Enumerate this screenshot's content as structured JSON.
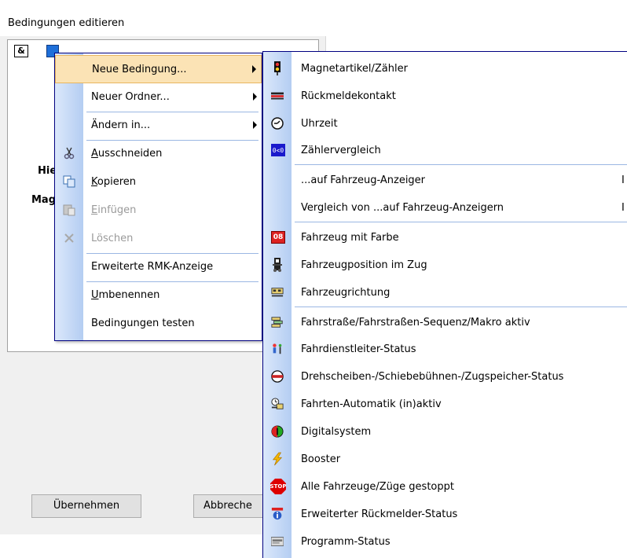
{
  "dialog": {
    "title": "Bedingungen editieren",
    "tree_and_label": "&",
    "tree_label_1": "Hie",
    "tree_label_2": "Mag",
    "apply_button": "Übernehmen",
    "cancel_button": "Abbreche"
  },
  "context_menu": {
    "items": [
      {
        "label": "Neue Bedingung...",
        "submenu": true,
        "highlighted": true
      },
      {
        "label": "Neuer Ordner...",
        "submenu": true
      },
      {
        "label": "Ändern in...",
        "submenu": true
      },
      {
        "label": "Ausschneiden",
        "icon": "scissors-icon",
        "mnemonic": "A"
      },
      {
        "label": "Kopieren",
        "icon": "copy-icon",
        "mnemonic": "K"
      },
      {
        "label": "Einfügen",
        "icon": "paste-icon",
        "mnemonic": "E",
        "disabled": true
      },
      {
        "label": "Löschen",
        "icon": "delete-icon",
        "disabled": true
      },
      {
        "label": "Erweiterte RMK-Anzeige"
      },
      {
        "label": "Umbenennen",
        "mnemonic": "U"
      },
      {
        "label": "Bedingungen testen"
      }
    ]
  },
  "submenu": {
    "items": [
      {
        "label": "Magnetartikel/Zähler",
        "icon": "signal-icon"
      },
      {
        "label": "Rückmeldekontakt",
        "icon": "feedback-contact-icon"
      },
      {
        "label": "Uhrzeit",
        "icon": "clock-icon"
      },
      {
        "label": "Zählervergleich",
        "icon": "counter-compare-icon",
        "icon_text": "0<0"
      },
      {
        "label": "...auf Fahrzeug-Anzeiger",
        "icon": "",
        "overflow_glyph": "I"
      },
      {
        "label": "Vergleich von ...auf Fahrzeug-Anzeigern",
        "icon": "",
        "overflow_glyph": "I"
      },
      {
        "label": "Fahrzeug mit Farbe",
        "icon": "vehicle-color-icon",
        "icon_text": "08"
      },
      {
        "label": "Fahrzeugposition im Zug",
        "icon": "train-position-icon"
      },
      {
        "label": "Fahrzeugrichtung",
        "icon": "vehicle-direction-icon"
      },
      {
        "label": "Fahrstraße/Fahrstraßen-Sequenz/Makro aktiv",
        "icon": "route-icon"
      },
      {
        "label": "Fahrdienstleiter-Status",
        "icon": "dispatcher-icon"
      },
      {
        "label": "Drehscheiben-/Schiebebühnen-/Zugspeicher-Status",
        "icon": "turntable-icon"
      },
      {
        "label": "Fahrten-Automatik (in)aktiv",
        "icon": "automatic-icon"
      },
      {
        "label": "Digitalsystem",
        "icon": "digital-system-icon"
      },
      {
        "label": "Booster",
        "icon": "booster-icon"
      },
      {
        "label": "Alle Fahrzeuge/Züge gestoppt",
        "icon": "stop-icon",
        "icon_text": "STOP"
      },
      {
        "label": "Erweiterter Rückmelder-Status",
        "icon": "info-icon"
      },
      {
        "label": "Programm-Status",
        "icon": "program-icon"
      }
    ]
  },
  "colors": {
    "menu_highlight": "#fbe3b5",
    "menu_border": "#000080",
    "menu_strip": "#b4cdf2"
  }
}
